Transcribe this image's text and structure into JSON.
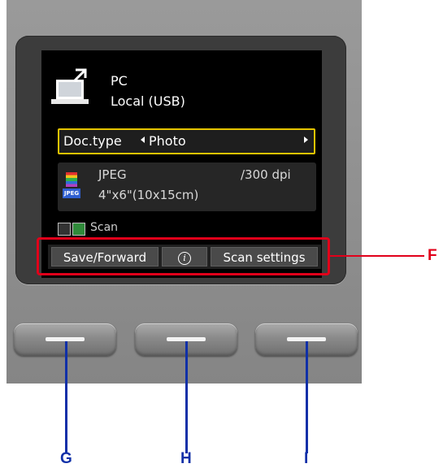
{
  "screen": {
    "destination": {
      "title": "PC",
      "subtitle": "Local (USB)",
      "icon": "pc-icon"
    },
    "doc_type": {
      "label": "Doc.type",
      "value": "Photo"
    },
    "file_info": {
      "format": "JPEG",
      "resolution": "/300 dpi",
      "size": "4\"x6\"(10x15cm)",
      "icon": "jpeg-icon"
    },
    "scan_label": "Scan",
    "softkeys": {
      "left": "Save/Forward",
      "center": "i",
      "right": "Scan settings"
    }
  },
  "callouts": {
    "softkeys": "F",
    "left_button": "G",
    "center_button": "H",
    "right_button": "I"
  },
  "colors": {
    "highlight": "#e5c400",
    "callout_red": "#e1001a",
    "callout_blue": "#1030a8"
  }
}
